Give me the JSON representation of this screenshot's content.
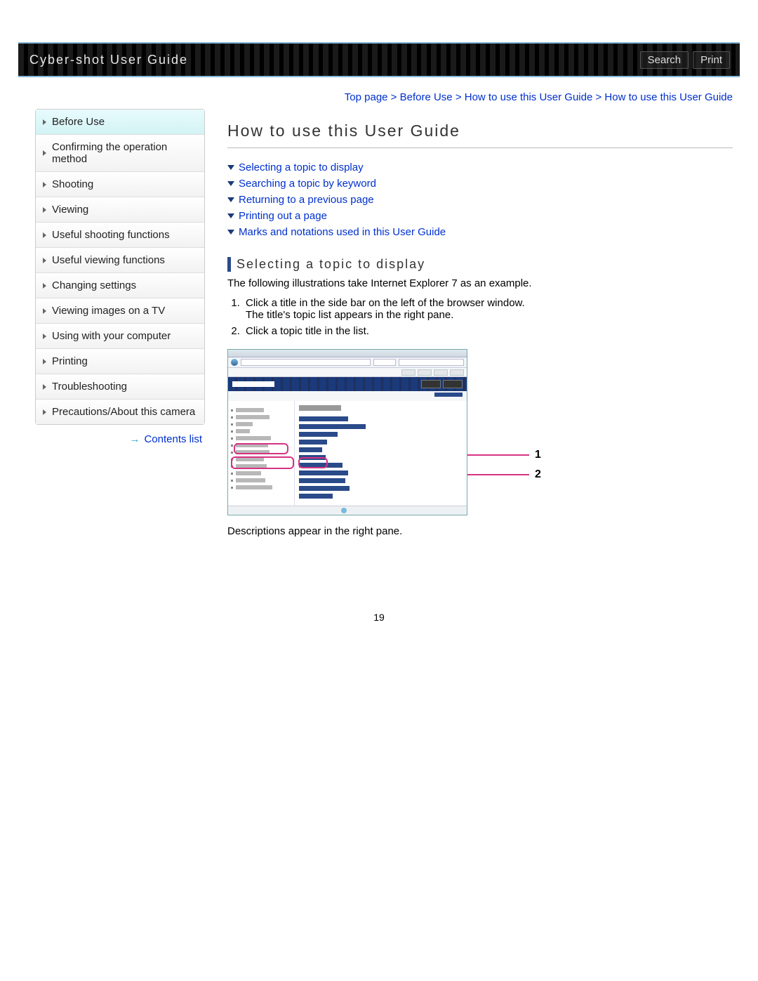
{
  "header": {
    "title": "Cyber-shot User Guide",
    "search_label": "Search",
    "print_label": "Print"
  },
  "breadcrumb": "Top page > Before Use > How to use this User Guide > How to use this User Guide",
  "sidebar": {
    "items": [
      {
        "label": "Before Use",
        "active": true
      },
      {
        "label": "Confirming the operation method"
      },
      {
        "label": "Shooting"
      },
      {
        "label": "Viewing"
      },
      {
        "label": "Useful shooting functions"
      },
      {
        "label": "Useful viewing functions"
      },
      {
        "label": "Changing settings"
      },
      {
        "label": "Viewing images on a TV"
      },
      {
        "label": "Using with your computer"
      },
      {
        "label": "Printing"
      },
      {
        "label": "Troubleshooting"
      },
      {
        "label": "Precautions/About this camera"
      }
    ],
    "contents_link": "Contents list"
  },
  "main": {
    "title": "How to use this User Guide",
    "jump_links": [
      "Selecting a topic to display",
      "Searching a topic by keyword",
      "Returning to a previous page",
      "Printing out a page",
      "Marks and notations used in this User Guide"
    ],
    "section_title": "Selecting a topic to display",
    "intro": "The following illustrations take Internet Explorer 7 as an example.",
    "steps": [
      "Click a title in the side bar on the left of the browser window.\nThe title's topic list appears in the right pane.",
      "Click a topic title in the list."
    ],
    "callouts": {
      "one": "1",
      "two": "2"
    },
    "after_text": "Descriptions appear in the right pane."
  },
  "page_number": "19"
}
